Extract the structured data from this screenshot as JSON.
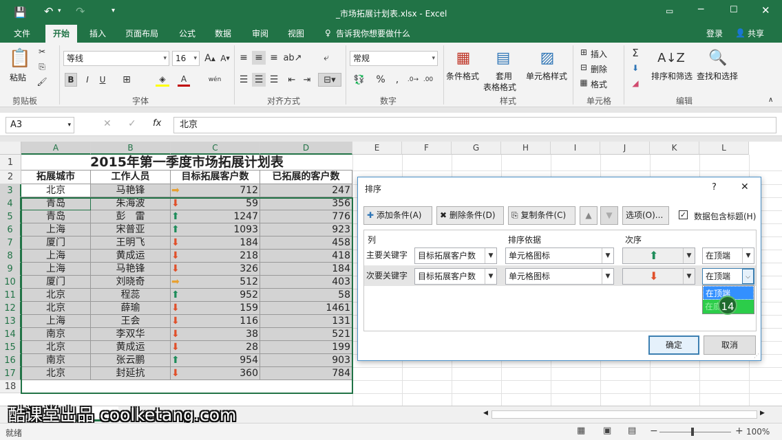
{
  "window": {
    "title": "_市场拓展计划表.xlsx - Excel"
  },
  "menu": {
    "tabs": [
      "文件",
      "开始",
      "插入",
      "页面布局",
      "公式",
      "数据",
      "审阅",
      "视图"
    ],
    "active": "开始",
    "tell_me": "告诉我你想要做什么",
    "login": "登录",
    "share": "共享"
  },
  "ribbon": {
    "paste": "粘贴",
    "clipboard": "剪贴板",
    "font_name": "等线",
    "font_size": "16",
    "font_group": "字体",
    "align_group": "对齐方式",
    "number_format": "常规",
    "number_group": "数字",
    "cond_format": "条件格式",
    "table_format_1": "套用",
    "table_format_2": "表格格式",
    "cell_styles": "单元格样式",
    "styles_group": "样式",
    "insert": "插入",
    "delete": "删除",
    "format": "格式",
    "cells_group": "单元格",
    "sort_filter": "排序和筛选",
    "find_select": "查找和选择",
    "edit_group": "编辑"
  },
  "formula_bar": {
    "name_box": "A3",
    "fx": "fx",
    "value": "北京"
  },
  "sheet": {
    "columns": [
      "A",
      "B",
      "C",
      "D",
      "E",
      "F",
      "G",
      "H",
      "I",
      "J",
      "K",
      "L"
    ],
    "rows": [
      "1",
      "2",
      "3",
      "4",
      "5",
      "6",
      "7",
      "8",
      "9",
      "10",
      "11",
      "12",
      "13",
      "14",
      "15",
      "16",
      "17",
      "18"
    ],
    "title": "2015年第一季度市场拓展计划表",
    "headers": [
      "拓展城市",
      "工作人员",
      "目标拓展客户数",
      "已拓展的客户数"
    ],
    "data": [
      {
        "city": "北京",
        "person": "马艳锋",
        "icon": "right",
        "target": "712",
        "done": "247"
      },
      {
        "city": "青岛",
        "person": "朱海波",
        "icon": "down",
        "target": "59",
        "done": "356"
      },
      {
        "city": "青岛",
        "person": "彭　雷",
        "icon": "up",
        "target": "1247",
        "done": "776"
      },
      {
        "city": "上海",
        "person": "宋普亚",
        "icon": "up",
        "target": "1093",
        "done": "923"
      },
      {
        "city": "厦门",
        "person": "王明飞",
        "icon": "down",
        "target": "184",
        "done": "458"
      },
      {
        "city": "上海",
        "person": "黄成运",
        "icon": "down",
        "target": "218",
        "done": "418"
      },
      {
        "city": "上海",
        "person": "马艳锋",
        "icon": "down",
        "target": "326",
        "done": "184"
      },
      {
        "city": "厦门",
        "person": "刘晓奇",
        "icon": "right",
        "target": "512",
        "done": "403"
      },
      {
        "city": "北京",
        "person": "程蕊",
        "icon": "up",
        "target": "952",
        "done": "58"
      },
      {
        "city": "北京",
        "person": "薛瑜",
        "icon": "down",
        "target": "159",
        "done": "1461"
      },
      {
        "city": "上海",
        "person": "王会",
        "icon": "down",
        "target": "116",
        "done": "131"
      },
      {
        "city": "南京",
        "person": "李双华",
        "icon": "down",
        "target": "38",
        "done": "521"
      },
      {
        "city": "北京",
        "person": "黄成运",
        "icon": "down",
        "target": "28",
        "done": "199"
      },
      {
        "city": "南京",
        "person": "张云鹏",
        "icon": "up",
        "target": "954",
        "done": "903"
      },
      {
        "city": "北京",
        "person": "封延抗",
        "icon": "down",
        "target": "360",
        "done": "784"
      }
    ]
  },
  "dialog": {
    "title": "排序",
    "help": "?",
    "close": "✕",
    "add": "添加条件(A)",
    "delete": "删除条件(D)",
    "copy": "复制条件(C)",
    "options": "选项(O)...",
    "has_header": "数据包含标题(H)",
    "col_header": "列",
    "sort_on_header": "排序依据",
    "order_header": "次序",
    "rows": [
      {
        "label": "主要关键字",
        "column": "目标拓展客户数",
        "sort_on": "单元格图标",
        "icon": "up",
        "position": "在顶端"
      },
      {
        "label": "次要关键字",
        "column": "目标拓展客户数",
        "sort_on": "单元格图标",
        "icon": "down",
        "position": "在顶端"
      }
    ],
    "dropdown_options": [
      "在顶端",
      "在底端"
    ],
    "badge": "14",
    "ok": "确定",
    "cancel": "取消"
  },
  "watermark": "酷课堂出品 coolketang.com",
  "status": {
    "ready": "就绪",
    "zoom": "100%"
  },
  "colors": {
    "excel_green": "#217346",
    "up": "#1e8c5a",
    "down": "#e0502a",
    "right": "#e8a030"
  }
}
